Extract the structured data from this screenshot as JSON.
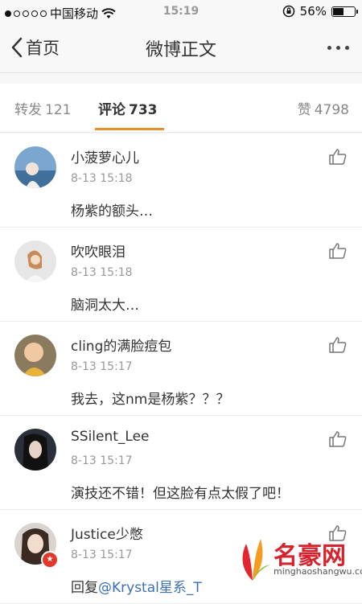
{
  "status_bar": {
    "carrier": "中国移动",
    "time": "15:19",
    "battery": "56%",
    "battery_level": 0.56
  },
  "nav": {
    "back_label": "首页",
    "title": "微博正文"
  },
  "tabs": [
    {
      "label": "转发",
      "count": "121"
    },
    {
      "label": "评论",
      "count": "733"
    },
    {
      "label": "赞",
      "count": "4798"
    }
  ],
  "comments": [
    {
      "name": "小菠萝心儿",
      "time": "8-13 15:18",
      "text": "杨紫的额头…"
    },
    {
      "name": "吹吹眼泪",
      "time": "8-13 15:18",
      "text": "脑洞太大…"
    },
    {
      "name": "cling的满脸痘包",
      "time": "8-13 15:17",
      "text": "我去，这nm是杨紫？？？"
    },
    {
      "name": "SSilent_Lee",
      "time": "8-13 15:17",
      "text": "演技还不错！但这脸有点太假了吧！"
    },
    {
      "name": "Justice少憋",
      "time": "8-13 15:17",
      "text_prefix": "回复",
      "text_link": "@Krystal星系_T"
    }
  ],
  "watermark": {
    "name": "名豪网",
    "url": "minghaoshangwu.com"
  },
  "colors": {
    "accent": "#e5902a",
    "link": "#3b6fb6",
    "watermark": "#d6242f"
  }
}
